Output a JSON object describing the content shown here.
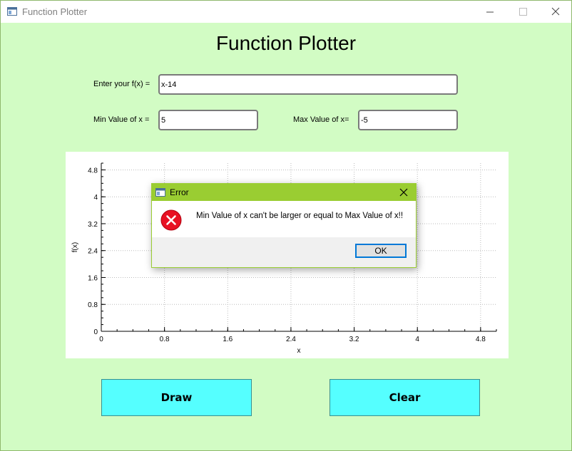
{
  "window": {
    "title": "Function Plotter",
    "icon": "window-app-icon"
  },
  "header": {
    "title": "Function Plotter"
  },
  "form": {
    "fx_label": "Enter your f(x) =",
    "fx_value": "x-14",
    "min_label": "Min Value of x =",
    "min_value": "5",
    "max_label": "Max Value of x=",
    "max_value": "-5"
  },
  "buttons": {
    "draw": "Draw",
    "clear": "Clear"
  },
  "colors": {
    "background": "#d2fcc4",
    "button": "#55ffff",
    "dialog_title": "#9acd32",
    "error": "#e81123"
  },
  "chart_data": {
    "type": "line",
    "xlabel": "x",
    "ylabel": "f(x)",
    "xlim": [
      0,
      5
    ],
    "ylim": [
      0,
      5
    ],
    "xticks": [
      "0",
      "0.8",
      "1.6",
      "2.4",
      "3.2",
      "4",
      "4.8"
    ],
    "yticks": [
      "0",
      "0.8",
      "1.6",
      "2.4",
      "3.2",
      "4",
      "4.8"
    ],
    "grid": true,
    "series": []
  },
  "dialog": {
    "title": "Error",
    "icon": "error-icon",
    "message": "Min Value of x can't be larger or equal to Max Value of x!!",
    "ok_label": "OK"
  }
}
